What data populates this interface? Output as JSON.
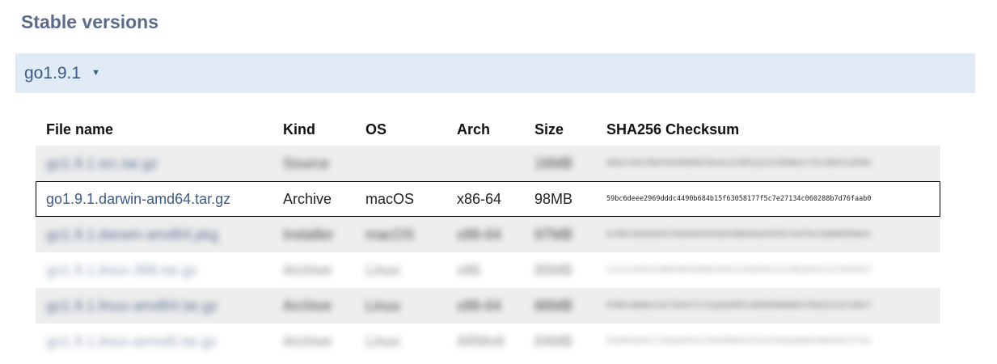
{
  "section": {
    "title": "Stable versions"
  },
  "version": {
    "label": "go1.9.1",
    "caret": "▼"
  },
  "table": {
    "headers": {
      "file": "File name",
      "kind": "Kind",
      "os": "OS",
      "arch": "Arch",
      "size": "Size",
      "checksum": "SHA256 Checksum"
    },
    "rows": [
      {
        "file": "go1.9.1.src.tar.gz",
        "kind": "Source",
        "os": "",
        "arch": "",
        "size": "16MB",
        "checksum": "a84afc9dc7d64fe0fa84d4d735e2ece23831a22117b50dafc75c1484f1cb550e"
      },
      {
        "file": "go1.9.1.darwin-amd64.tar.gz",
        "kind": "Archive",
        "os": "macOS",
        "arch": "x86-64",
        "size": "98MB",
        "checksum": "59bc6deee2969dddc4490b684b15f63058177f5c7e27134c060288b7d76faab0"
      },
      {
        "file": "go1.9.1.darwin-amd64.pkg",
        "kind": "Installer",
        "os": "macOS",
        "arch": "x86-64",
        "size": "97MB",
        "checksum": "dc3b6c3d2e6a5d1f2b4e8e5a4fbd2e3b6b4de4e35f0cfbaf54c5ad60b63b0a4c"
      },
      {
        "file": "go1.9.1.linux-386.tar.gz",
        "kind": "Archive",
        "os": "Linux",
        "arch": "x86",
        "size": "85MB",
        "checksum": "2cea1ce9325cb40839601b566bc02b11c92b2942c21110b1b254c7e72e5581e7"
      },
      {
        "file": "go1.9.1.linux-amd64.tar.gz",
        "kind": "Archive",
        "os": "Linux",
        "arch": "x86-64",
        "size": "86MB",
        "checksum": "07d81c6b6b4c2dcf1b5ef7c27aaebd3691cdb40548500941f92b221147c5d9c7"
      },
      {
        "file": "go1.9.1.linux-armv6l.tar.gz",
        "kind": "Archive",
        "os": "Linux",
        "arch": "ARMv6",
        "size": "84MB",
        "checksum": "65a0495a50c7c240a6487b1170939586332f6c8f3526abdbb9140935b3cff14c"
      }
    ]
  }
}
